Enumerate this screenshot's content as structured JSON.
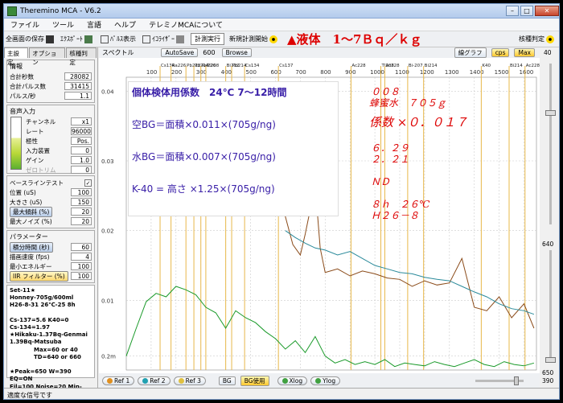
{
  "window": {
    "title": "Theremino MCA - V6.2",
    "minimize": "–",
    "maximize": "□",
    "close": "✕"
  },
  "menu": [
    "ファイル",
    "ツール",
    "言語",
    "ヘルプ",
    "テレミノMCAについて"
  ],
  "toolbar": {
    "save": "全画面の保存",
    "export": "ｴｸｽﾎﾟｰﾄ",
    "pulse": "ﾊﾟﾙｽ表示",
    "equalizer": "ｲｺﾗｲｻﾞｰ",
    "measure": "計測実行",
    "newmeasure": "新規計測開始",
    "headline": "▲液体　1～7Ｂｑ／ｋｇ",
    "nuclide": "核種判定"
  },
  "left": {
    "tabs": [
      "主設定",
      "オプション",
      "核種判定"
    ],
    "info": {
      "title": "情報",
      "rows": [
        {
          "label": "合計秒数",
          "value": "28082"
        },
        {
          "label": "合計パルス数",
          "value": "31415"
        },
        {
          "label": "パルス/秒",
          "value": "1.1"
        }
      ]
    },
    "audio": {
      "title": "音声入力",
      "rows": [
        {
          "label": "チャンネル",
          "value": "x1"
        },
        {
          "label": "レート",
          "value": "96000"
        },
        {
          "label": "極性",
          "value": "Pos."
        },
        {
          "label": "入力装置",
          "value": "0"
        },
        {
          "label": "ゲイン",
          "value": "1.0"
        },
        {
          "label": "ゼロトリム",
          "value": "0"
        }
      ]
    },
    "baseline": {
      "title": "ベースラインテスト",
      "check": "✓",
      "rows": [
        {
          "label": "位置 (uS)",
          "value": "100"
        },
        {
          "label": "大きさ (uS)",
          "value": "150"
        },
        {
          "label": "最大傾斜 (%)",
          "value": "20"
        },
        {
          "label": "最大ノイズ (%)",
          "value": "20"
        }
      ]
    },
    "params": {
      "title": "パラメーター",
      "rows": [
        {
          "label": "積分時間 (秒)",
          "value": "60"
        },
        {
          "label": "描画速度 (fps)",
          "value": "4"
        },
        {
          "label": "最小エネルギー",
          "value": "100"
        },
        {
          "label": "IIR フィルター (%)",
          "value": "100"
        }
      ]
    },
    "notes": [
      "Set-11★",
      "Honney-705g/600ml",
      "H26-8-31 26℃-25 8h",
      "",
      "Cs-137=5.6  K40=0",
      "Cs-134=1.97",
      "★Hikaku-1.37Bq-Genmai",
      "1.39Bq-Matsuba",
      "Max=60 or 40 TD=640 or 660",
      "",
      "★Peak=650 W=390 EQ=ON",
      "Fil=100  Noise=20  Min-E=100",
      "Gain=1.0 PC-vol=9"
    ]
  },
  "chart_toolbar": {
    "label": "スペクトル",
    "autosave": "AutoSave",
    "value": "600",
    "browse": "Browse",
    "line": "線グラフ",
    "cps": "cps",
    "max": "Max",
    "right_value": "40"
  },
  "overlay": [
    "個体検体用係数　24℃ 7～12時間",
    "空BG＝面積×0.011×(705g/ng)",
    "水BG＝面積×0.007×(705g/ng)",
    "K-40 = 高さ ×1.25×(705g/ng)"
  ],
  "handwritten": [
    "００８",
    "蜂蜜水　７０５ｇ",
    "係数 ×０．０１７",
    "６．２９",
    "２．２１",
    "ＮＤ",
    "８ｈ　２６℃",
    "Ｈ２６－８"
  ],
  "bottom": {
    "ref1": "Ref 1",
    "ref2": "Ref 2",
    "ref3": "Ref 3",
    "bg": "BG",
    "bguse": "BG使用",
    "xlog": "Xlog",
    "ylog": "Ylog"
  },
  "right": {
    "top": "40",
    "mid": "640",
    "bot1": "650",
    "bot2": "390"
  },
  "status": "適度な信号です",
  "chart_data": {
    "type": "line",
    "x_ticks": [
      100,
      200,
      300,
      400,
      500,
      600,
      700,
      800,
      900,
      1000,
      1100,
      1200,
      1300,
      1400,
      1500,
      1600
    ],
    "xlim": [
      0,
      1650
    ],
    "y_ticks": [
      "0.04",
      "0.03",
      "0.02",
      "0.01",
      "0.2m"
    ],
    "ylim": [
      0,
      0.042
    ],
    "nuclide_labels": [
      "Cs134",
      "Ra226",
      "Pb212",
      "Pb214",
      "Ra226",
      "Tl208",
      "Bi212",
      "Pb214",
      "Cs134",
      "Cs137",
      "Ac228",
      "Tl208",
      "Ac228",
      "Bi-207",
      "Bi214",
      "K40",
      "Bi214",
      "Ac228"
    ],
    "nuclide_positions": [
      34,
      45,
      60,
      68,
      75,
      80,
      100,
      106,
      119,
      153,
      226,
      256,
      260,
      283,
      299,
      357,
      385,
      401
    ],
    "series": [
      {
        "name": "brown",
        "color": "#8a4a18",
        "x": [
          560,
          600,
          640,
          670,
          700,
          720,
          760,
          780,
          800,
          850,
          900,
          950,
          1000,
          1050,
          1100,
          1150,
          1200,
          1250,
          1300,
          1350,
          1400,
          1450,
          1500,
          1550,
          1600,
          1640
        ],
        "y": [
          0.0405,
          0.03,
          0.022,
          0.018,
          0.0165,
          0.0195,
          0.0265,
          0.0175,
          0.014,
          0.0145,
          0.0135,
          0.0142,
          0.0138,
          0.0132,
          0.013,
          0.012,
          0.0128,
          0.0122,
          0.0125,
          0.016,
          0.009,
          0.0085,
          0.0105,
          0.0075,
          0.0095,
          0.006
        ]
      },
      {
        "name": "teal",
        "color": "#2a8a9a",
        "x": [
          640,
          680,
          720,
          760,
          800,
          850,
          900,
          950,
          1000,
          1050,
          1100,
          1150,
          1200,
          1250,
          1300,
          1350,
          1400,
          1450,
          1500,
          1550,
          1600,
          1640
        ],
        "y": [
          0.02,
          0.019,
          0.0182,
          0.0175,
          0.0172,
          0.0165,
          0.017,
          0.016,
          0.015,
          0.0145,
          0.014,
          0.0138,
          0.0133,
          0.013,
          0.0128,
          0.012,
          0.0112,
          0.0105,
          0.0095,
          0.0088,
          0.0085,
          0.008
        ]
      },
      {
        "name": "green",
        "color": "#1a9a2a",
        "x": [
          0,
          40,
          80,
          120,
          160,
          200,
          240,
          280,
          320,
          360,
          400,
          440,
          480,
          520,
          560,
          600,
          640,
          680,
          720,
          760,
          800,
          840,
          880,
          920,
          960,
          1000,
          1040,
          1080,
          1120,
          1160,
          1200,
          1240,
          1280,
          1320,
          1360,
          1400,
          1440,
          1480,
          1520,
          1560,
          1600,
          1640
        ],
        "y": [
          0.002,
          0.006,
          0.0098,
          0.011,
          0.0105,
          0.012,
          0.0115,
          0.0108,
          0.009,
          0.0082,
          0.006,
          0.0085,
          0.0075,
          0.0068,
          0.0055,
          0.0045,
          0.003,
          0.0042,
          0.0025,
          0.0048,
          0.002,
          0.001,
          0.0015,
          0.0008,
          0.0012,
          0.0008,
          0.0015,
          0.0005,
          0.001,
          0.0008,
          0.0006,
          0.0012,
          0.0008,
          0.0005,
          0.001,
          0.0015,
          0.0008,
          0.0005,
          0.0012,
          0.0008,
          0.0006,
          0.001
        ]
      }
    ]
  }
}
